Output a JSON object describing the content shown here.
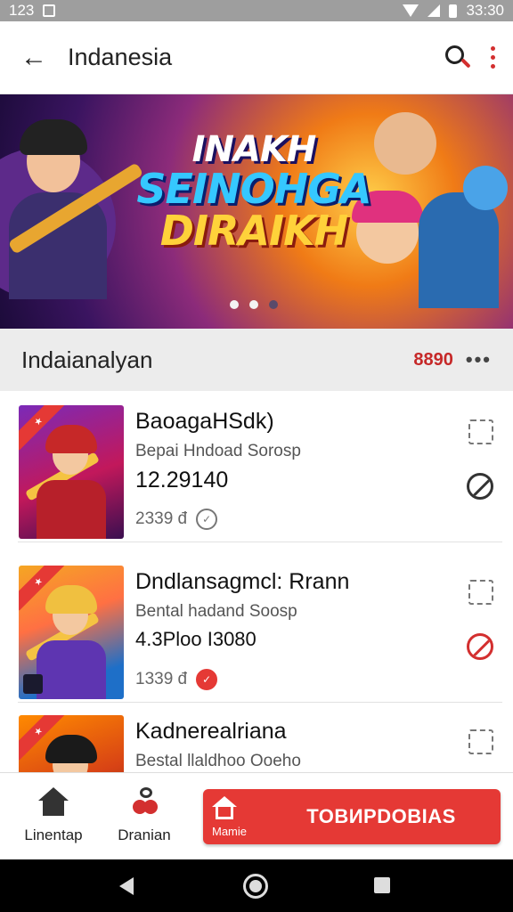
{
  "status_bar": {
    "left_text": "123",
    "time": "33:30"
  },
  "app_bar": {
    "title": "Indanesia"
  },
  "banner": {
    "line1": "INAKH",
    "line2": "SEINOHGA",
    "line3": "DIRAIKH",
    "slides": 3,
    "active_slide": 1
  },
  "section": {
    "title": "Indaianalyan",
    "count": "8890"
  },
  "games": [
    {
      "title": "BaoagaHSdk)",
      "subtitle": "Bepai Hndoad Sorosp",
      "price": "12.29140",
      "meta": "2339 đ"
    },
    {
      "title": "Dndlansagmcl: Rrann",
      "subtitle": "Bental hadand Soosp",
      "price": "4.3Ploo I3080",
      "meta": "1339 đ"
    },
    {
      "title": "Kadnerealriana",
      "subtitle": "Bestal llaldhoo Ooeho"
    }
  ],
  "bottom_nav": {
    "home_label": "Linentap",
    "discover_label": "Dranian",
    "cta_sub": "Mamie",
    "cta_label": "TOBИPDOBIAS"
  },
  "colors": {
    "accent": "#e53935",
    "dark_red": "#d32f2f",
    "status_bar": "#9e9e9e"
  }
}
